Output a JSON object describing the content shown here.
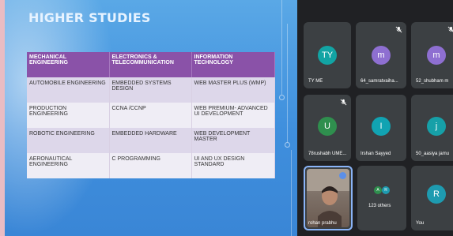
{
  "slide": {
    "title": "HIGHER STUDIES",
    "table": {
      "headers": [
        "MECHANICAL ENGINEERING",
        "ELECTRONICS & TELECOMMUNICATION",
        "INFORMATION TECHNOLOGY"
      ],
      "rows": [
        [
          "AUTOMOBILE ENGINEERING",
          "EMBEDDED SYSTEMS DESIGN",
          "WEB MASTER PLUS (WMP)"
        ],
        [
          "PRODUCTION ENGINEERING",
          "CCNA /CCNP",
          "WEB PREMIUM- ADVANCED UI DEVELOPMENT"
        ],
        [
          "ROBOTIC ENGINEERING",
          "EMBEDDED HARDWARE",
          "WEB DEVELOPMENT MASTER"
        ],
        [
          "AERONAUTICAL ENGINEERING",
          "C PROGRAMMING",
          "UI AND UX DESIGN STANDARD"
        ]
      ]
    }
  },
  "participants": [
    {
      "initials": "TY",
      "name": "TY ME",
      "color": "#12a4a4",
      "muted": false
    },
    {
      "initials": "m",
      "name": "64_samratvaiha...",
      "color": "#8e6fd1",
      "muted": true
    },
    {
      "initials": "m",
      "name": "52_shubham m",
      "color": "#8e6fd1",
      "muted": true
    },
    {
      "initials": "U",
      "name": "78rushabh UME...",
      "color": "#2f8f4e",
      "muted": true
    },
    {
      "initials": "I",
      "name": "Irshan Sayyed",
      "color": "#11a3b2",
      "muted": false
    },
    {
      "initials": "j",
      "name": "50_aasiya jamu",
      "color": "#16a0a8",
      "muted": false
    },
    {
      "initials": "",
      "name": "rohan prabhu",
      "color": "",
      "muted": false
    },
    {
      "initials": "",
      "name": "123 others",
      "color": "",
      "muted": false
    },
    {
      "initials": "R",
      "name": "You",
      "color": "#1e9bb0",
      "muted": false
    }
  ],
  "others": {
    "avatars": [
      {
        "initials": "A",
        "color": "#2f8f4e"
      },
      {
        "initials": "R",
        "color": "#1e9bb0"
      }
    ]
  },
  "colors": {
    "slide_bg": "#3f8fdd",
    "table_header": "#8a52a8",
    "panel_bg": "#202124",
    "tile_bg": "#3c4043",
    "border_pink": "#e9bcc3"
  }
}
